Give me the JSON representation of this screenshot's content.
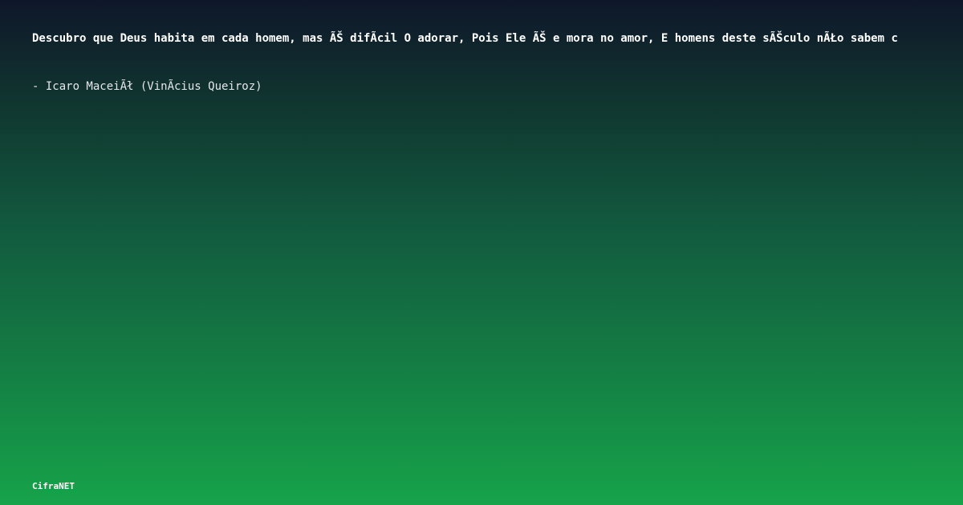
{
  "quote": {
    "text": "Descubro que Deus habita em cada homem, mas ÃŠ difÃ­cil O adorar, Pois Ele ÃŠ e mora no amor, E homens deste sÃŠculo nÃŁo sabem c"
  },
  "author": {
    "text": "- Icaro MaceiÃł (VinÃ­cius Queiroz)"
  },
  "brand": {
    "name": "CifraNET"
  },
  "colors": {
    "gradient_top": "#0f172a",
    "gradient_bottom": "#16a34a",
    "text": "#ffffff"
  }
}
